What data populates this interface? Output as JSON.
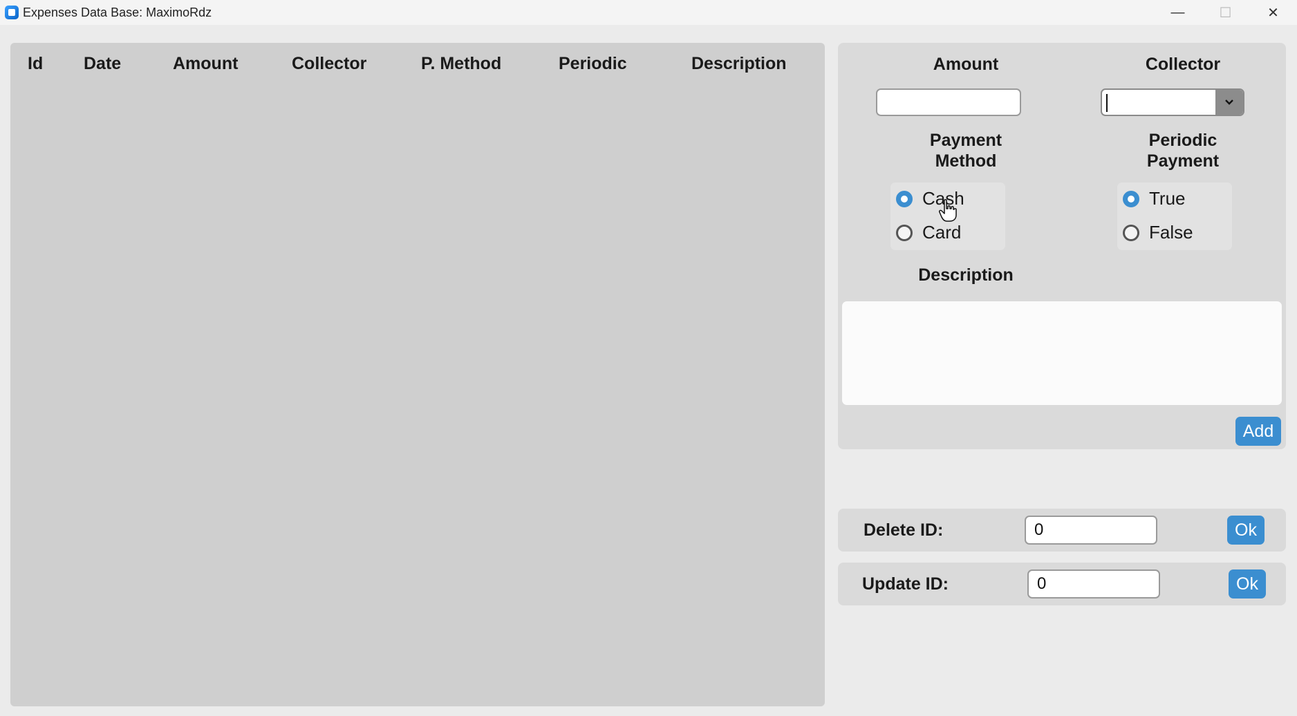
{
  "window": {
    "title": "Expenses Data Base: MaximoRdz",
    "minimize": "—",
    "maximize": "☐",
    "close": "✕"
  },
  "table": {
    "columns": [
      "Id",
      "Date",
      "Amount",
      "Collector",
      "P. Method",
      "Periodic",
      "Description"
    ],
    "rows": []
  },
  "form": {
    "amount_label": "Amount",
    "amount_value": "",
    "collector_label": "Collector",
    "collector_value": "",
    "payment_method_label_line1": "Payment",
    "payment_method_label_line2": "Method",
    "payment_options": [
      {
        "label": "Cash",
        "checked": true
      },
      {
        "label": "Card",
        "checked": false
      }
    ],
    "periodic_label_line1": "Periodic",
    "periodic_label_line2": "Payment",
    "periodic_options": [
      {
        "label": "True",
        "checked": true
      },
      {
        "label": "False",
        "checked": false
      }
    ],
    "description_label": "Description",
    "description_value": "",
    "add_button": "Add"
  },
  "delete": {
    "label": "Delete ID:",
    "value": "0",
    "button": "Ok"
  },
  "update": {
    "label": "Update ID:",
    "value": "0",
    "button": "Ok"
  },
  "colors": {
    "accent": "#3b8ed0",
    "panel": "#dadada",
    "table_bg": "#cfcfcf"
  }
}
